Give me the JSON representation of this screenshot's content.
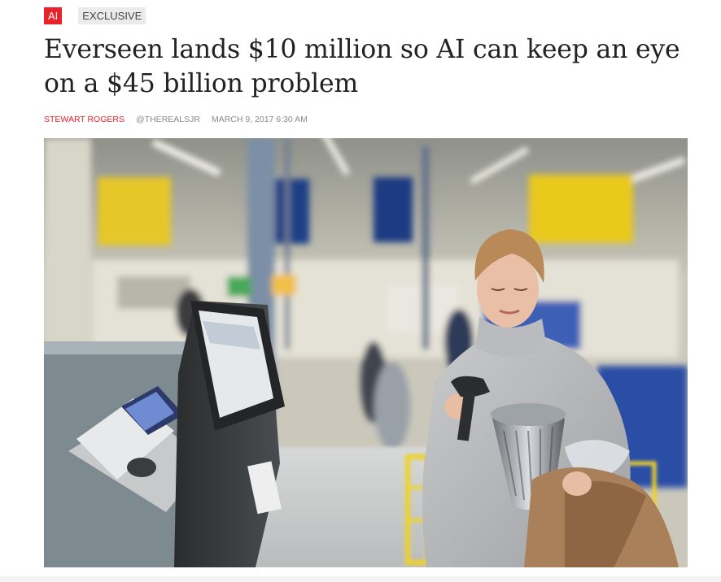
{
  "tags": {
    "category": "AI",
    "label": "EXCLUSIVE"
  },
  "article": {
    "headline": "Everseen lands $10 million so AI can keep an eye on a $45 billion problem",
    "author": "STEWART ROGERS",
    "handle": "@THEREALSJR",
    "date": "MARCH 9, 2017 6:30 AM"
  },
  "colors": {
    "accent": "#e8222b",
    "tag_bg": "#ebebeb",
    "meta_text": "#8a8a8a",
    "headline_text": "#222222"
  },
  "hero_image": {
    "icons": [
      "self-checkout-kiosk",
      "barcode-scanner",
      "utensil-holder"
    ]
  }
}
